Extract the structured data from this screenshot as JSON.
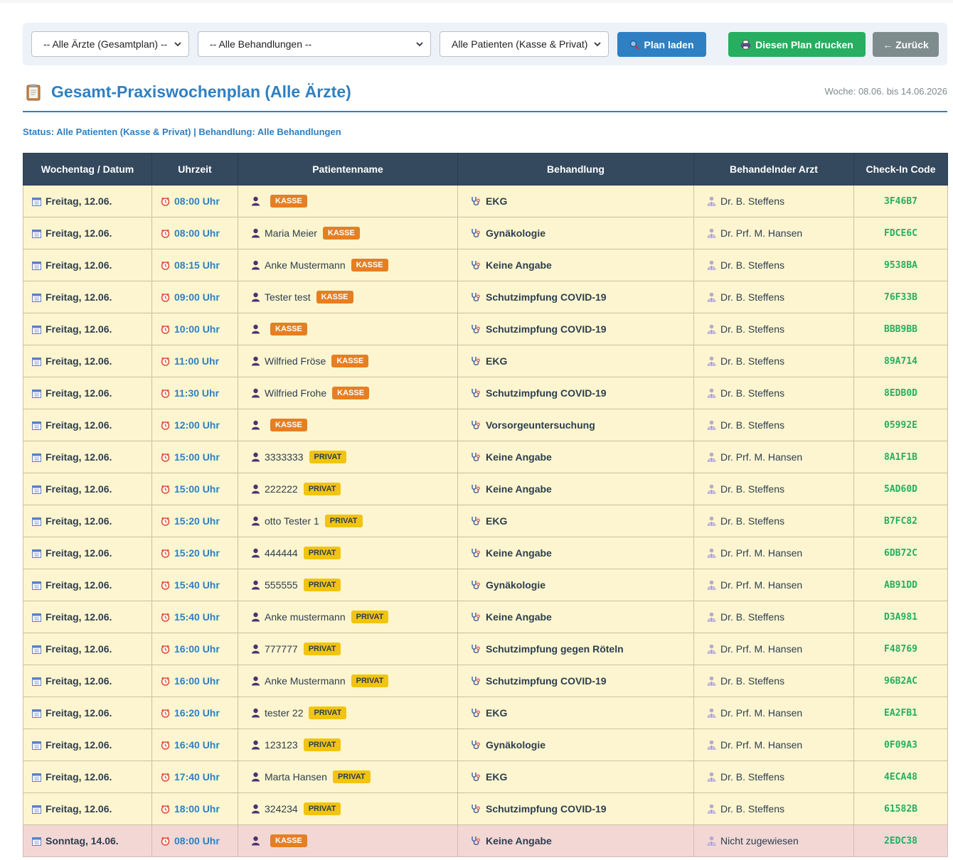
{
  "filters": {
    "doctor_select": "-- Alle Ärzte (Gesamtplan) --",
    "treatment_select": "-- Alle Behandlungen --",
    "patient_select": "Alle Patienten (Kasse & Privat)",
    "load_button": "Plan laden",
    "print_button": "Diesen Plan drucken",
    "back_button": "← Zurück"
  },
  "header": {
    "title": "Gesamt-Praxiswochenplan (Alle Ärzte)",
    "week": "Woche: 08.06. bis 14.06.2026",
    "status": "Status: Alle Patienten (Kasse & Privat) | Behandlung: Alle Behandlungen"
  },
  "table": {
    "headers": [
      "Wochentag / Datum",
      "Uhrzeit",
      "Patientenname",
      "Behandlung",
      "Behandelnder Arzt",
      "Check-In Code"
    ],
    "rows": [
      {
        "day": "Freitag, 12.06.",
        "time": "08:00 Uhr",
        "name": "",
        "badge": "KASSE",
        "treatment": "EKG",
        "doctor": "Dr. B. Steffens",
        "code": "3F46B7"
      },
      {
        "day": "Freitag, 12.06.",
        "time": "08:00 Uhr",
        "name": "Maria Meier",
        "badge": "KASSE",
        "treatment": "Gynäkologie",
        "doctor": "Dr. Prf. M. Hansen",
        "code": "FDCE6C"
      },
      {
        "day": "Freitag, 12.06.",
        "time": "08:15 Uhr",
        "name": "Anke Mustermann",
        "badge": "KASSE",
        "treatment": "Keine Angabe",
        "doctor": "Dr. B. Steffens",
        "code": "9538BA"
      },
      {
        "day": "Freitag, 12.06.",
        "time": "09:00 Uhr",
        "name": "Tester test",
        "badge": "KASSE",
        "treatment": "Schutzimpfung COVID-19",
        "doctor": "Dr. B. Steffens",
        "code": "76F33B"
      },
      {
        "day": "Freitag, 12.06.",
        "time": "10:00 Uhr",
        "name": "",
        "badge": "KASSE",
        "treatment": "Schutzimpfung COVID-19",
        "doctor": "Dr. B. Steffens",
        "code": "BBB9BB"
      },
      {
        "day": "Freitag, 12.06.",
        "time": "11:00 Uhr",
        "name": "Wilfried Fröse",
        "badge": "KASSE",
        "treatment": "EKG",
        "doctor": "Dr. B. Steffens",
        "code": "89A714"
      },
      {
        "day": "Freitag, 12.06.",
        "time": "11:30 Uhr",
        "name": "Wilfried Frohe",
        "badge": "KASSE",
        "treatment": "Schutzimpfung COVID-19",
        "doctor": "Dr. B. Steffens",
        "code": "8EDB0D"
      },
      {
        "day": "Freitag, 12.06.",
        "time": "12:00 Uhr",
        "name": "",
        "badge": "KASSE",
        "treatment": "Vorsorgeuntersuchung",
        "doctor": "Dr. B. Steffens",
        "code": "05992E"
      },
      {
        "day": "Freitag, 12.06.",
        "time": "15:00 Uhr",
        "name": "3333333",
        "badge": "PRIVAT",
        "treatment": "Keine Angabe",
        "doctor": "Dr. Prf. M. Hansen",
        "code": "8A1F1B"
      },
      {
        "day": "Freitag, 12.06.",
        "time": "15:00 Uhr",
        "name": "222222",
        "badge": "PRIVAT",
        "treatment": "Keine Angabe",
        "doctor": "Dr. B. Steffens",
        "code": "5AD60D"
      },
      {
        "day": "Freitag, 12.06.",
        "time": "15:20 Uhr",
        "name": "otto Tester 1",
        "badge": "PRIVAT",
        "treatment": "EKG",
        "doctor": "Dr. B. Steffens",
        "code": "B7FC82"
      },
      {
        "day": "Freitag, 12.06.",
        "time": "15:20 Uhr",
        "name": "444444",
        "badge": "PRIVAT",
        "treatment": "Keine Angabe",
        "doctor": "Dr. Prf. M. Hansen",
        "code": "6DB72C"
      },
      {
        "day": "Freitag, 12.06.",
        "time": "15:40 Uhr",
        "name": "555555",
        "badge": "PRIVAT",
        "treatment": "Gynäkologie",
        "doctor": "Dr. Prf. M. Hansen",
        "code": "AB91DD"
      },
      {
        "day": "Freitag, 12.06.",
        "time": "15:40 Uhr",
        "name": "Anke mustermann",
        "badge": "PRIVAT",
        "treatment": "Keine Angabe",
        "doctor": "Dr. B. Steffens",
        "code": "D3A981"
      },
      {
        "day": "Freitag, 12.06.",
        "time": "16:00 Uhr",
        "name": "777777",
        "badge": "PRIVAT",
        "treatment": "Schutzimpfung gegen Röteln",
        "doctor": "Dr. Prf. M. Hansen",
        "code": "F48769"
      },
      {
        "day": "Freitag, 12.06.",
        "time": "16:00 Uhr",
        "name": "Anke Mustermann",
        "badge": "PRIVAT",
        "treatment": "Schutzimpfung COVID-19",
        "doctor": "Dr. B. Steffens",
        "code": "96B2AC"
      },
      {
        "day": "Freitag, 12.06.",
        "time": "16:20 Uhr",
        "name": "tester 22",
        "badge": "PRIVAT",
        "treatment": "EKG",
        "doctor": "Dr. Prf. M. Hansen",
        "code": "EA2FB1"
      },
      {
        "day": "Freitag, 12.06.",
        "time": "16:40 Uhr",
        "name": "123123",
        "badge": "PRIVAT",
        "treatment": "Gynäkologie",
        "doctor": "Dr. Prf. M. Hansen",
        "code": "0F09A3"
      },
      {
        "day": "Freitag, 12.06.",
        "time": "17:40 Uhr",
        "name": "Marta Hansen",
        "badge": "PRIVAT",
        "treatment": "EKG",
        "doctor": "Dr. B. Steffens",
        "code": "4ECA48"
      },
      {
        "day": "Freitag, 12.06.",
        "time": "18:00 Uhr",
        "name": "324234",
        "badge": "PRIVAT",
        "treatment": "Schutzimpfung COVID-19",
        "doctor": "Dr. B. Steffens",
        "code": "61582B"
      },
      {
        "day": "Sonntag, 14.06.",
        "time": "08:00 Uhr",
        "name": "",
        "badge": "KASSE",
        "treatment": "Keine Angabe",
        "doctor": "Nicht zugewiesen",
        "code": "2EDC38"
      }
    ]
  },
  "colors": {
    "accent": "#2f80c2",
    "header_bg": "#34495e",
    "row_bg": "#fdf5cf",
    "unassigned_bg": "#f2d7d5",
    "kasse": "#e67e22",
    "privat": "#f1c40f",
    "code": "#27ae60"
  },
  "icons": [
    "clipboard-icon",
    "search-icon",
    "printer-icon",
    "calendar-icon",
    "alarm-clock-icon",
    "person-icon",
    "stethoscope-icon",
    "doctor-icon",
    "chevron-down-icon"
  ]
}
